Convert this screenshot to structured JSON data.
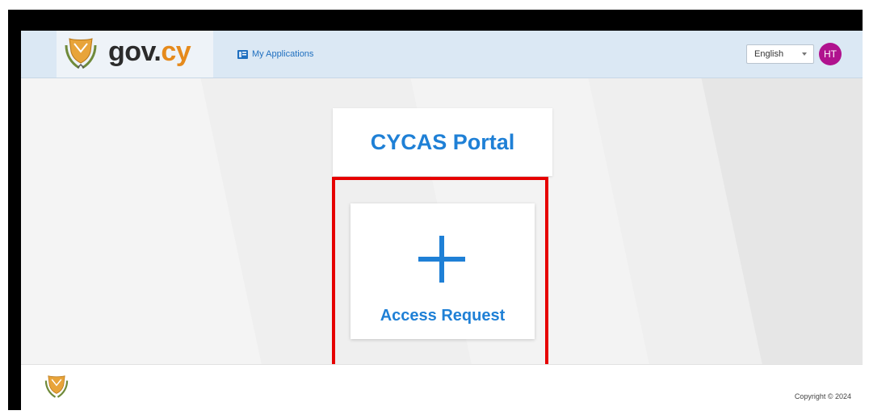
{
  "header": {
    "brand_gov": "gov.",
    "brand_cy": "cy",
    "my_applications": "My Applications",
    "language": "English",
    "user_initials": "HT"
  },
  "main": {
    "portal_title": "CYCAS Portal",
    "access_request_label": "Access Request"
  },
  "footer": {
    "copyright": "Copyright © 2024"
  },
  "icons": {
    "crest": "cyprus-coat-of-arms-icon",
    "apps": "applications-icon",
    "plus": "plus-icon"
  },
  "colors": {
    "accent": "#1f80d6",
    "brand_orange": "#e58a1c",
    "avatar": "#b0128e",
    "highlight": "#e60000"
  }
}
